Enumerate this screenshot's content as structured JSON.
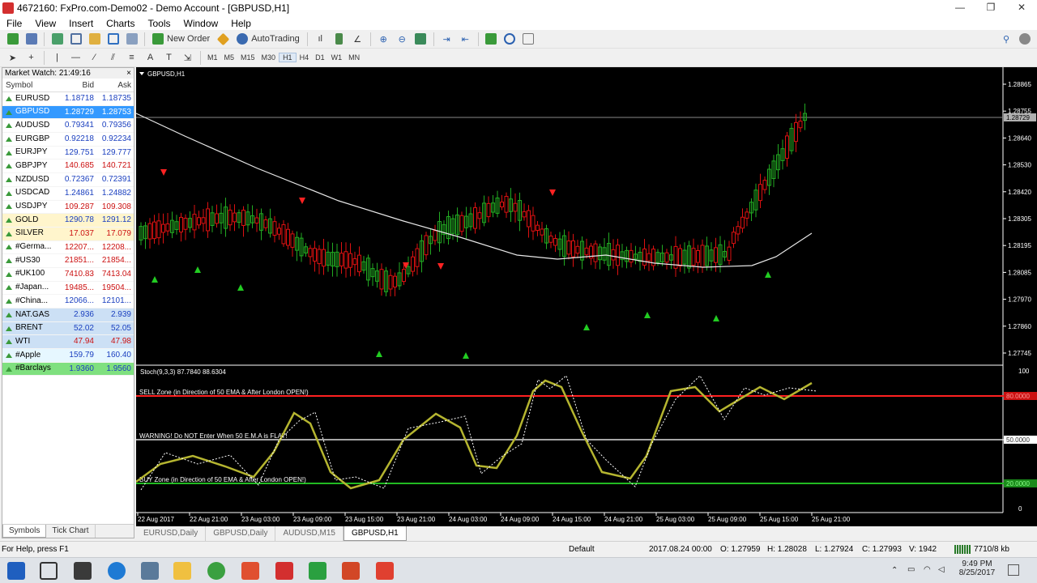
{
  "window": {
    "title": "4672160: FxPro.com-Demo02 - Demo Account - [GBPUSD,H1]",
    "minimize": "—",
    "restore": "❐",
    "close": "✕"
  },
  "menu": [
    "File",
    "View",
    "Insert",
    "Charts",
    "Tools",
    "Window",
    "Help"
  ],
  "toolbar": {
    "new_order": "New Order",
    "autotrading": "AutoTrading"
  },
  "timeframes": [
    "M1",
    "M5",
    "M15",
    "M30",
    "H1",
    "H4",
    "D1",
    "W1",
    "MN"
  ],
  "active_timeframe": "H1",
  "market_watch": {
    "title": "Market Watch: 21:49:16",
    "close": "×",
    "headers": {
      "symbol": "Symbol",
      "bid": "Bid",
      "ask": "Ask"
    },
    "rows": [
      {
        "symbol": "EURUSD",
        "bid": "1.18718",
        "ask": "1.18735",
        "dir": "up",
        "color": "blue",
        "bg": "#ffffff"
      },
      {
        "symbol": "GBPUSD",
        "bid": "1.28729",
        "ask": "1.28753",
        "dir": "up",
        "color": "white",
        "bg": "#3399ff"
      },
      {
        "symbol": "AUDUSD",
        "bid": "0.79341",
        "ask": "0.79356",
        "dir": "up",
        "color": "blue",
        "bg": "#ffffff"
      },
      {
        "symbol": "EURGBP",
        "bid": "0.92218",
        "ask": "0.92234",
        "dir": "up",
        "color": "blue",
        "bg": "#ffffff"
      },
      {
        "symbol": "EURJPY",
        "bid": "129.751",
        "ask": "129.777",
        "dir": "up",
        "color": "blue",
        "bg": "#ffffff"
      },
      {
        "symbol": "GBPJPY",
        "bid": "140.685",
        "ask": "140.721",
        "dir": "up",
        "color": "red",
        "bg": "#ffffff"
      },
      {
        "symbol": "NZDUSD",
        "bid": "0.72367",
        "ask": "0.72391",
        "dir": "up",
        "color": "blue",
        "bg": "#ffffff"
      },
      {
        "symbol": "USDCAD",
        "bid": "1.24861",
        "ask": "1.24882",
        "dir": "up",
        "color": "blue",
        "bg": "#ffffff"
      },
      {
        "symbol": "USDJPY",
        "bid": "109.287",
        "ask": "109.308",
        "dir": "up",
        "color": "red",
        "bg": "#ffffff"
      },
      {
        "symbol": "GOLD",
        "bid": "1290.78",
        "ask": "1291.12",
        "dir": "up",
        "color": "blue",
        "bg": "#fff5cc"
      },
      {
        "symbol": "SILVER",
        "bid": "17.037",
        "ask": "17.079",
        "dir": "up",
        "color": "red",
        "bg": "#fff5cc"
      },
      {
        "symbol": "#Germa...",
        "bid": "12207...",
        "ask": "12208...",
        "dir": "up",
        "color": "red",
        "bg": "#ffffff"
      },
      {
        "symbol": "#US30",
        "bid": "21851...",
        "ask": "21854...",
        "dir": "up",
        "color": "red",
        "bg": "#ffffff"
      },
      {
        "symbol": "#UK100",
        "bid": "7410.83",
        "ask": "7413.04",
        "dir": "up",
        "color": "red",
        "bg": "#ffffff"
      },
      {
        "symbol": "#Japan...",
        "bid": "19485...",
        "ask": "19504...",
        "dir": "up",
        "color": "red",
        "bg": "#ffffff"
      },
      {
        "symbol": "#China...",
        "bid": "12066...",
        "ask": "12101...",
        "dir": "up",
        "color": "blue",
        "bg": "#ffffff"
      },
      {
        "symbol": "NAT.GAS",
        "bid": "2.936",
        "ask": "2.939",
        "dir": "up",
        "color": "blue",
        "bg": "#cce0f5"
      },
      {
        "symbol": "BRENT",
        "bid": "52.02",
        "ask": "52.05",
        "dir": "up",
        "color": "blue",
        "bg": "#cce0f5"
      },
      {
        "symbol": "WTI",
        "bid": "47.94",
        "ask": "47.98",
        "dir": "up",
        "color": "red",
        "bg": "#cce0f5"
      },
      {
        "symbol": "#Apple",
        "bid": "159.79",
        "ask": "160.40",
        "dir": "up",
        "color": "blue",
        "bg": "#e6f7ff"
      },
      {
        "symbol": "#Barclays",
        "bid": "1.9360",
        "ask": "1.9560",
        "dir": "up",
        "color": "blue",
        "bg": "#7fe07f"
      }
    ],
    "tabs": [
      "Symbols",
      "Tick Chart"
    ]
  },
  "chart": {
    "symbol_label": "GBPUSD,H1",
    "price_ticks": [
      "1.28865",
      "1.28755",
      "1.28640",
      "1.28530",
      "1.28420",
      "1.28305",
      "1.28195",
      "1.28085",
      "1.27970",
      "1.27860",
      "1.27745"
    ],
    "current_price": "1.28729",
    "stoch_label": "Stoch(9,3,3) 87.7840 88.6304",
    "stoch_ticks": [
      "100",
      "0"
    ],
    "sell_zone_label": "SELL Zone (in Direction of 50 EMA & After London OPEN!)",
    "warning_label": "WARNING! Do NOT Enter When 50 E.M.A is FLAT!",
    "buy_zone_label": "BUY Zone (in Direction of 50 EMA & After London OPEN!)",
    "level_80": "80.0000",
    "level_50": "50.0000",
    "level_20": "20.0000",
    "time_ticks": [
      "22 Aug 2017",
      "22 Aug 21:00",
      "23 Aug 03:00",
      "23 Aug 09:00",
      "23 Aug 15:00",
      "23 Aug 21:00",
      "24 Aug 03:00",
      "24 Aug 09:00",
      "24 Aug 15:00",
      "24 Aug 21:00",
      "25 Aug 03:00",
      "25 Aug 09:00",
      "25 Aug 15:00",
      "25 Aug 21:00"
    ],
    "colors": {
      "bull": "#22aa22",
      "bear": "#dd1111",
      "ema": "#e8e8e8",
      "stoch_main": "#b5b530",
      "stoch_signal": "#ffffff",
      "sell_line": "#ff2020",
      "buy_line": "#22bb22"
    }
  },
  "chart_tabs": [
    "EURUSD,Daily",
    "GBPUSD,Daily",
    "AUDUSD,M15",
    "GBPUSD,H1"
  ],
  "status": {
    "help": "For Help, press F1",
    "profile": "Default",
    "datetime": "2017.08.24 00:00",
    "open": "O: 1.27959",
    "high": "H: 1.28028",
    "low": "L: 1.27924",
    "close": "C: 1.27993",
    "volume": "V: 1942",
    "traffic": "7710/8 kb"
  },
  "taskbar": {
    "time": "9:49 PM",
    "date": "8/25/2017"
  }
}
